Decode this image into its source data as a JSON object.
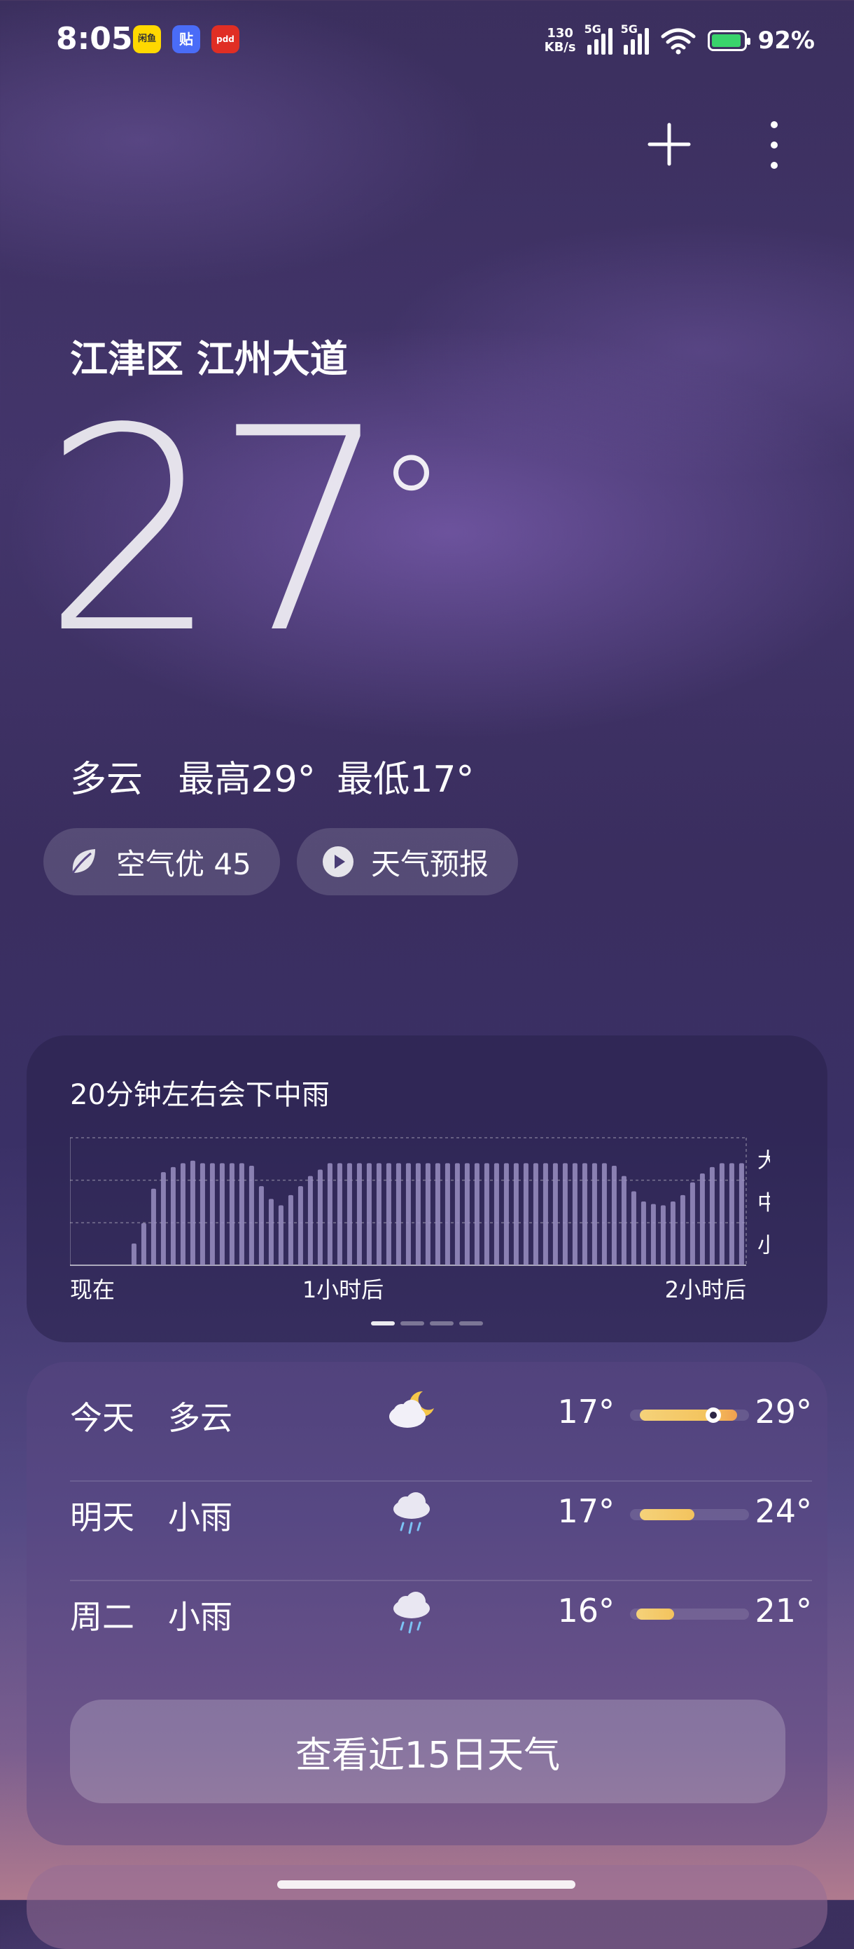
{
  "status_bar": {
    "time": "8:05",
    "app_icons": [
      "闲鱼",
      "贴",
      "pdd"
    ],
    "net_speed_value": "130",
    "net_speed_unit": "KB/s",
    "sim1": "5G",
    "sim2": "5G",
    "battery": "92%"
  },
  "location": "江津区 江州大道",
  "current": {
    "temp": "27",
    "degree": "°",
    "condition": "多云",
    "high": "最高29°",
    "low": "最低17°"
  },
  "chips": {
    "air": "空气优 45",
    "forecast": "天气预报"
  },
  "rain": {
    "title": "20分钟左右会下中雨",
    "levels": [
      "大",
      "中",
      "小"
    ],
    "time_labels": [
      "现在",
      "1小时后",
      "2小时后"
    ],
    "intensity": [
      0,
      0,
      0,
      0,
      0,
      0.17,
      0.33,
      0.6,
      0.73,
      0.77,
      0.8,
      0.82,
      0.8,
      0.8,
      0.8,
      0.8,
      0.8,
      0.78,
      0.62,
      0.52,
      0.47,
      0.55,
      0.62,
      0.7,
      0.75,
      0.8,
      0.8,
      0.8,
      0.8,
      0.8,
      0.8,
      0.8,
      0.8,
      0.8,
      0.8,
      0.8,
      0.8,
      0.8,
      0.8,
      0.8,
      0.8,
      0.8,
      0.8,
      0.8,
      0.8,
      0.8,
      0.8,
      0.8,
      0.8,
      0.8,
      0.8,
      0.8,
      0.8,
      0.8,
      0.78,
      0.7,
      0.58,
      0.5,
      0.48,
      0.47,
      0.5,
      0.55,
      0.65,
      0.72,
      0.77,
      0.8,
      0.8,
      0.8
    ],
    "pager_count": 4,
    "pager_active": 0
  },
  "daily": [
    {
      "day": "今天",
      "condition": "多云",
      "icon": "partly-cloudy-night-icon",
      "low": "17°",
      "high": "29°",
      "bar_start": 0.08,
      "bar_end": 0.9,
      "current_marker": 0.7
    },
    {
      "day": "明天",
      "condition": "小雨",
      "icon": "rain-cloud-icon",
      "low": "17°",
      "high": "24°",
      "bar_start": 0.08,
      "bar_end": 0.58
    },
    {
      "day": "周二",
      "condition": "小雨",
      "icon": "rain-cloud-icon",
      "low": "16°",
      "high": "21°",
      "bar_start": 0.05,
      "bar_end": 0.37
    }
  ],
  "view_15_days": "查看近15日天气",
  "colors": {
    "range_bar": "#f3c35d",
    "range_bar_warm": "#f0a050",
    "rain_bar": "#9a8fc2"
  }
}
